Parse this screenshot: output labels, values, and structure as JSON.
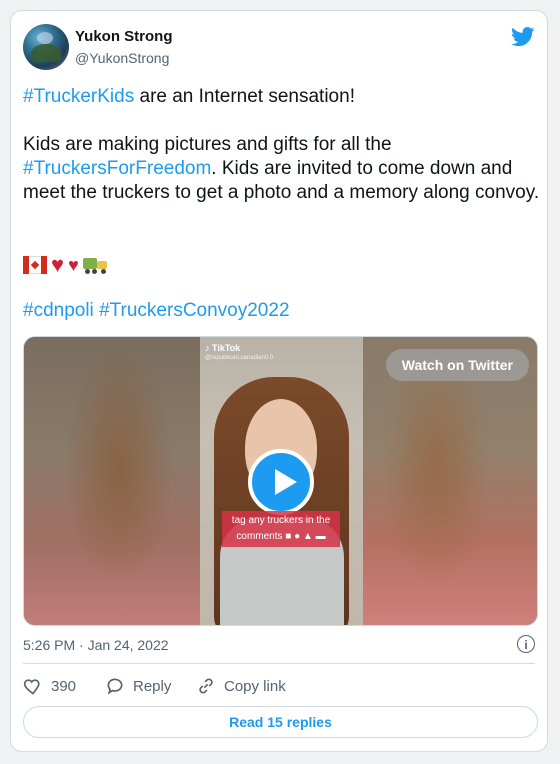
{
  "user": {
    "name": "Yukon Strong",
    "handle": "@YukonStrong"
  },
  "tweet": {
    "line1_hashtag": "#TruckerKids",
    "line1_rest": " are an Internet sensation!",
    "para2_part1": "Kids are making pictures and gifts for all the ",
    "para2_hashtag": "#TruckersForFreedom",
    "para2_part2": ". Kids are invited to come down and meet the truckers to get a photo and a memory along convoy.",
    "hashtag1": "#cdnpoli",
    "hashtag2": "#TruckersConvoy2022"
  },
  "video": {
    "watch_label": "Watch on Twitter",
    "tiktok_label": "TikTok",
    "tiktok_user": "@republican.canadian0.0",
    "caption_line1": "tag any truckers in the",
    "caption_line2": "comments"
  },
  "meta": {
    "timestamp": "5:26 PM · Jan 24, 2022"
  },
  "actions": {
    "like_count": "390",
    "reply_label": "Reply",
    "copy_label": "Copy link",
    "read_replies_label": "Read 15 replies"
  },
  "colors": {
    "accent": "#1d9bf0",
    "text": "#0f1419",
    "muted": "#536471"
  }
}
